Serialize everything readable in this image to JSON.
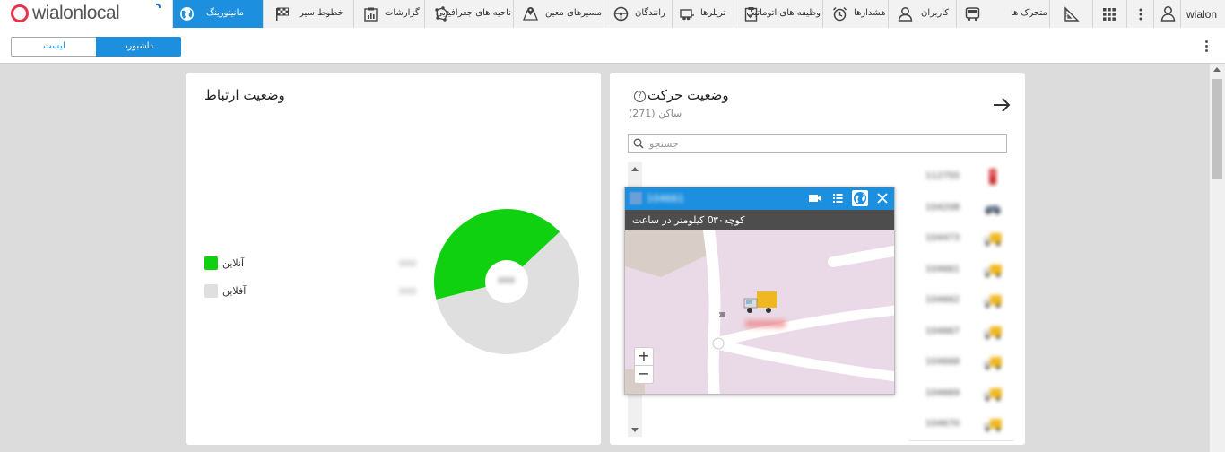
{
  "header": {
    "brand_text": "wialonlocal",
    "user_name": "wialon",
    "tabs": [
      {
        "label": "مانیتورینگ",
        "icon": "globe-icon",
        "active": true
      },
      {
        "label": "خطوط سیر",
        "icon": "checkered-flag-icon",
        "active": false
      },
      {
        "label": "گزارشات",
        "icon": "report-chart-icon",
        "active": false
      },
      {
        "label": "ناحیه های جغرافیایی",
        "icon": "geofence-polygon-icon",
        "active": false
      },
      {
        "label": "مسیرهای معین",
        "icon": "route-map-icon",
        "active": false
      },
      {
        "label": "رانندگان",
        "icon": "steering-wheel-icon",
        "active": false
      },
      {
        "label": "تریلرها",
        "icon": "trailer-icon",
        "active": false
      },
      {
        "label": "وظیفه های اتوماتیک",
        "icon": "task-clipboard-icon",
        "active": false
      },
      {
        "label": "هشدارها",
        "icon": "alarm-clock-icon",
        "active": false
      },
      {
        "label": "کاربران",
        "icon": "user-icon",
        "active": false
      },
      {
        "label": "متحرک ها",
        "icon": "bus-icon",
        "active": false
      }
    ]
  },
  "toolbar": {
    "list_label": "لیست",
    "dashboard_label": "داشبورد"
  },
  "connection": {
    "title": "وضعیت ارتباط",
    "legend": [
      {
        "label": "آنلاین",
        "color": "#0fd10f",
        "count": "000"
      },
      {
        "label": "آفلاین",
        "color": "#dfdfdf",
        "count": "000"
      }
    ],
    "online_fraction": 0.42,
    "center_label": "000"
  },
  "motion": {
    "title": "وضعیت حرکت",
    "subtitle": "ساکن (271)",
    "help": "?",
    "search_placeholder": "جستجو",
    "units": [
      {
        "name": "112755",
        "icon": "traffic-light-icon"
      },
      {
        "name": "104208",
        "icon": "car-icon"
      },
      {
        "name": "104473",
        "icon": "truck-icon"
      },
      {
        "name": "104661",
        "icon": "truck-icon"
      },
      {
        "name": "104662",
        "icon": "truck-icon"
      },
      {
        "name": "104667",
        "icon": "truck-icon"
      },
      {
        "name": "104668",
        "icon": "truck-icon"
      },
      {
        "name": "104669",
        "icon": "truck-icon"
      },
      {
        "name": "104670",
        "icon": "truck-icon"
      }
    ]
  },
  "popup": {
    "title": "104661",
    "speed": "0 کیلومتر در ساعت",
    "street": "کوچه۳۰",
    "zoom_in": "+",
    "zoom_out": "−"
  },
  "colors": {
    "accent": "#1c8fdf",
    "online": "#0fd10f",
    "offline": "#dfdfdf",
    "map_bg": "#ead9e6"
  }
}
